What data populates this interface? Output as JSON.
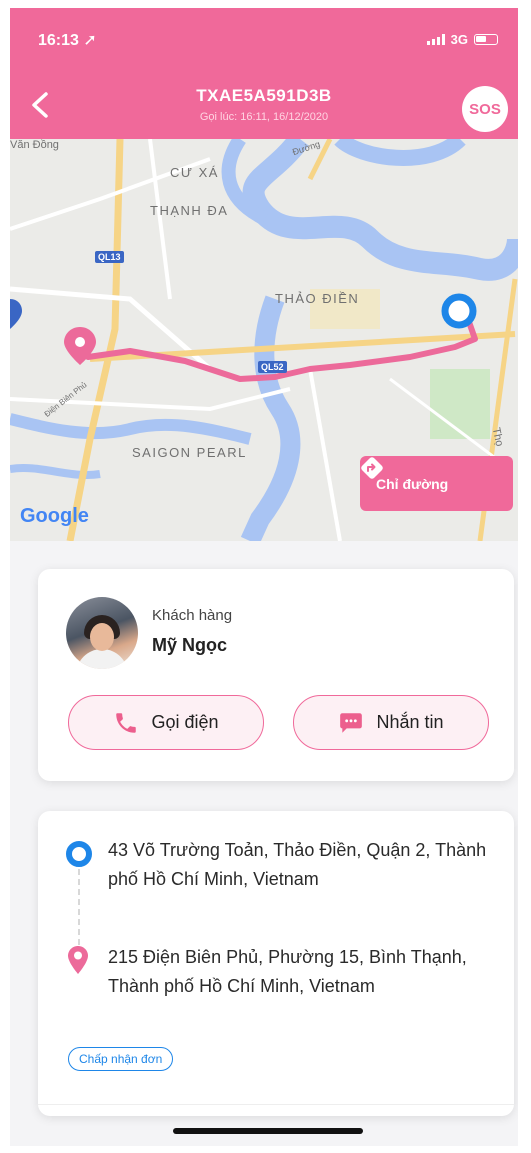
{
  "status_bar": {
    "time": "16:13",
    "network": "3G"
  },
  "header": {
    "title": "TXAE5A591D3B",
    "subtitle": "Gọi lúc: 16:11, 16/12/2020",
    "sos_label": "SOS"
  },
  "map": {
    "labels": {
      "district1": "CƯ XÁ",
      "district2": "THẠNH ĐA",
      "area_thao_dien": "THẢO ĐIỀN",
      "area_saigon_pearl": "SAIGON PEARL",
      "road_ql13": "QL13",
      "road_ql52": "QL52",
      "street_dbp": "Điện Biên Phủ",
      "street_vandong": "Văn Đồng",
      "street_duong": "Đường",
      "street_tho": "Thọ"
    },
    "attribution": "Google",
    "directions_label": "Chỉ đường"
  },
  "customer": {
    "label": "Khách hàng",
    "name": "Mỹ Ngọc",
    "call_label": "Gọi điện",
    "message_label": "Nhắn tin"
  },
  "trip": {
    "pickup": "43 Võ Trường Toản, Thảo Điền, Quận 2, Thành phố Hồ Chí Minh, Vietnam",
    "dropoff": "215 Điện Biên Phủ, Phường 15, Bình Thạnh, Thành phố Hồ Chí Minh, Vietnam",
    "accept_label": "Chấp nhận đơn"
  },
  "colors": {
    "brand": "#f0699a",
    "origin": "#1e86e8",
    "route": "#ec6a9a"
  },
  "icons": [
    "location-arrow-icon",
    "back-chevron-icon",
    "directions-icon",
    "phone-icon",
    "chat-icon",
    "origin-dot-icon",
    "destination-pin-icon"
  ]
}
